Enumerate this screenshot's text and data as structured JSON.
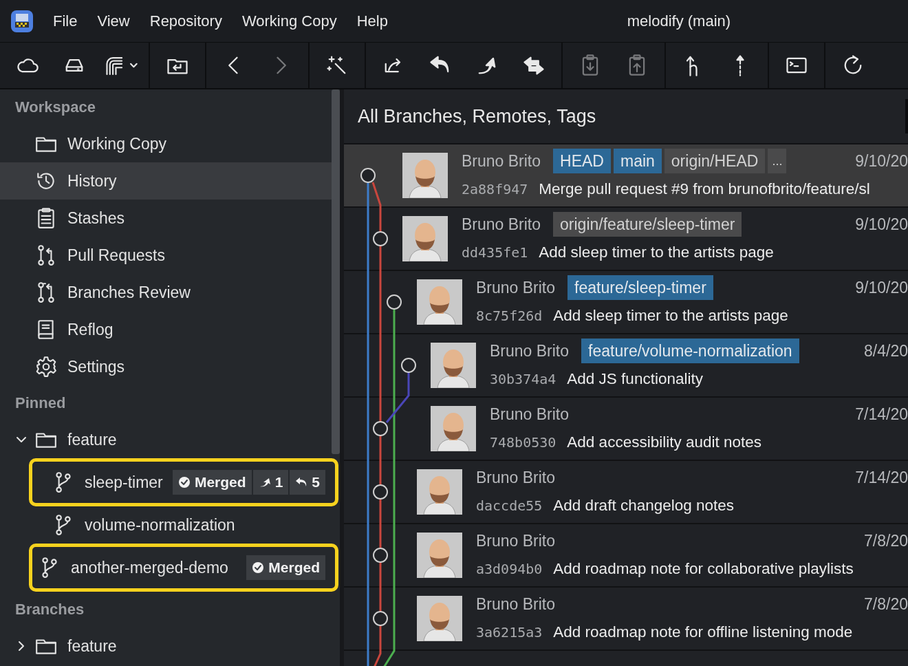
{
  "menu_bar": {
    "items": [
      "File",
      "View",
      "Repository",
      "Working Copy",
      "Help"
    ]
  },
  "window": {
    "title": "melodify (main)"
  },
  "toolbar": {
    "groups": [
      [
        {
          "kind": "cloud",
          "disabled": false
        },
        {
          "kind": "drive",
          "disabled": false
        },
        {
          "kind": "fetch",
          "disabled": false
        }
      ],
      [
        {
          "kind": "folder-return",
          "disabled": false
        }
      ],
      [
        {
          "kind": "back",
          "disabled": false
        },
        {
          "kind": "forward",
          "disabled": true
        }
      ],
      [
        {
          "kind": "wand",
          "disabled": false
        }
      ],
      [
        {
          "kind": "share",
          "disabled": false
        },
        {
          "kind": "pull",
          "disabled": false
        },
        {
          "kind": "push",
          "disabled": false
        },
        {
          "kind": "sync",
          "disabled": false
        }
      ],
      [
        {
          "kind": "clip-down",
          "disabled": true
        },
        {
          "kind": "clip-up",
          "disabled": true
        }
      ],
      [
        {
          "kind": "branch-fork",
          "disabled": false
        },
        {
          "kind": "dotted-up",
          "disabled": false
        }
      ],
      [
        {
          "kind": "terminal",
          "disabled": false
        }
      ],
      [
        {
          "kind": "refresh",
          "disabled": false
        }
      ]
    ]
  },
  "sidebar": {
    "sections": [
      {
        "title": "Workspace",
        "items": [
          {
            "kind": "folder",
            "label": "Working Copy",
            "selected": false
          },
          {
            "kind": "history",
            "label": "History",
            "selected": true
          },
          {
            "kind": "stashes",
            "label": "Stashes",
            "selected": false
          },
          {
            "kind": "pull-requests",
            "label": "Pull Requests",
            "selected": false
          },
          {
            "kind": "branches-review",
            "label": "Branches Review",
            "selected": false
          },
          {
            "kind": "reflog",
            "label": "Reflog",
            "selected": false
          },
          {
            "kind": "settings",
            "label": "Settings",
            "selected": false
          }
        ]
      },
      {
        "title": "Pinned",
        "items": [
          {
            "kind": "folder",
            "label": "feature",
            "expanded": true,
            "children": [
              {
                "kind": "branch",
                "label": "sleep-timer",
                "highlighted": true,
                "badges": [
                  {
                    "kind": "merged",
                    "label": "Merged"
                  },
                  {
                    "kind": "ahead",
                    "label": "1"
                  },
                  {
                    "kind": "behind",
                    "label": "5"
                  }
                ]
              },
              {
                "kind": "branch",
                "label": "volume-normalization",
                "highlighted": false
              }
            ]
          },
          {
            "kind": "branch",
            "label": "another-merged-demo",
            "highlighted": true,
            "badges": [
              {
                "kind": "merged",
                "label": "Merged"
              }
            ]
          }
        ]
      },
      {
        "title": "Branches",
        "items": [
          {
            "kind": "folder",
            "label": "feature",
            "expanded": false
          }
        ]
      }
    ]
  },
  "history": {
    "title": "All Branches, Remotes, Tags",
    "commits": [
      {
        "author": "Bruno Brito",
        "refs": [
          {
            "kind": "local",
            "label": "HEAD"
          },
          {
            "kind": "local",
            "label": "main"
          },
          {
            "kind": "remote",
            "label": "origin/HEAD"
          },
          {
            "kind": "more",
            "label": "..."
          }
        ],
        "hash": "2a88f947",
        "message": "Merge pull request #9 from brunofbrito/feature/sl",
        "date": "9/10/20",
        "selected": true
      },
      {
        "author": "Bruno Brito",
        "refs": [
          {
            "kind": "remote",
            "label": "origin/feature/sleep-timer"
          }
        ],
        "hash": "dd435fe1",
        "message": "Add sleep timer to the artists page",
        "date": "9/10/20",
        "selected": false
      },
      {
        "author": "Bruno Brito",
        "refs": [
          {
            "kind": "local",
            "label": "feature/sleep-timer"
          }
        ],
        "hash": "8c75f26d",
        "message": "Add sleep timer to the artists page",
        "date": "9/10/20",
        "selected": false
      },
      {
        "author": "Bruno Brito",
        "refs": [
          {
            "kind": "local",
            "label": "feature/volume-normalization"
          }
        ],
        "hash": "30b374a4",
        "message": "Add JS functionality",
        "date": "8/4/20",
        "selected": false
      },
      {
        "author": "Bruno Brito",
        "hash": "748b0530",
        "message": "Add accessibility audit notes",
        "date": "7/14/20",
        "selected": false
      },
      {
        "author": "Bruno Brito",
        "hash": "daccde55",
        "message": "Add draft changelog notes",
        "date": "7/14/20",
        "selected": false
      },
      {
        "author": "Bruno Brito",
        "hash": "a3d094b0",
        "message": "Add roadmap note for collaborative playlists",
        "date": "7/8/20",
        "selected": false
      },
      {
        "author": "Bruno Brito",
        "hash": "3a6215a3",
        "message": "Add roadmap note for offline listening mode",
        "date": "7/8/20",
        "selected": false
      }
    ]
  }
}
